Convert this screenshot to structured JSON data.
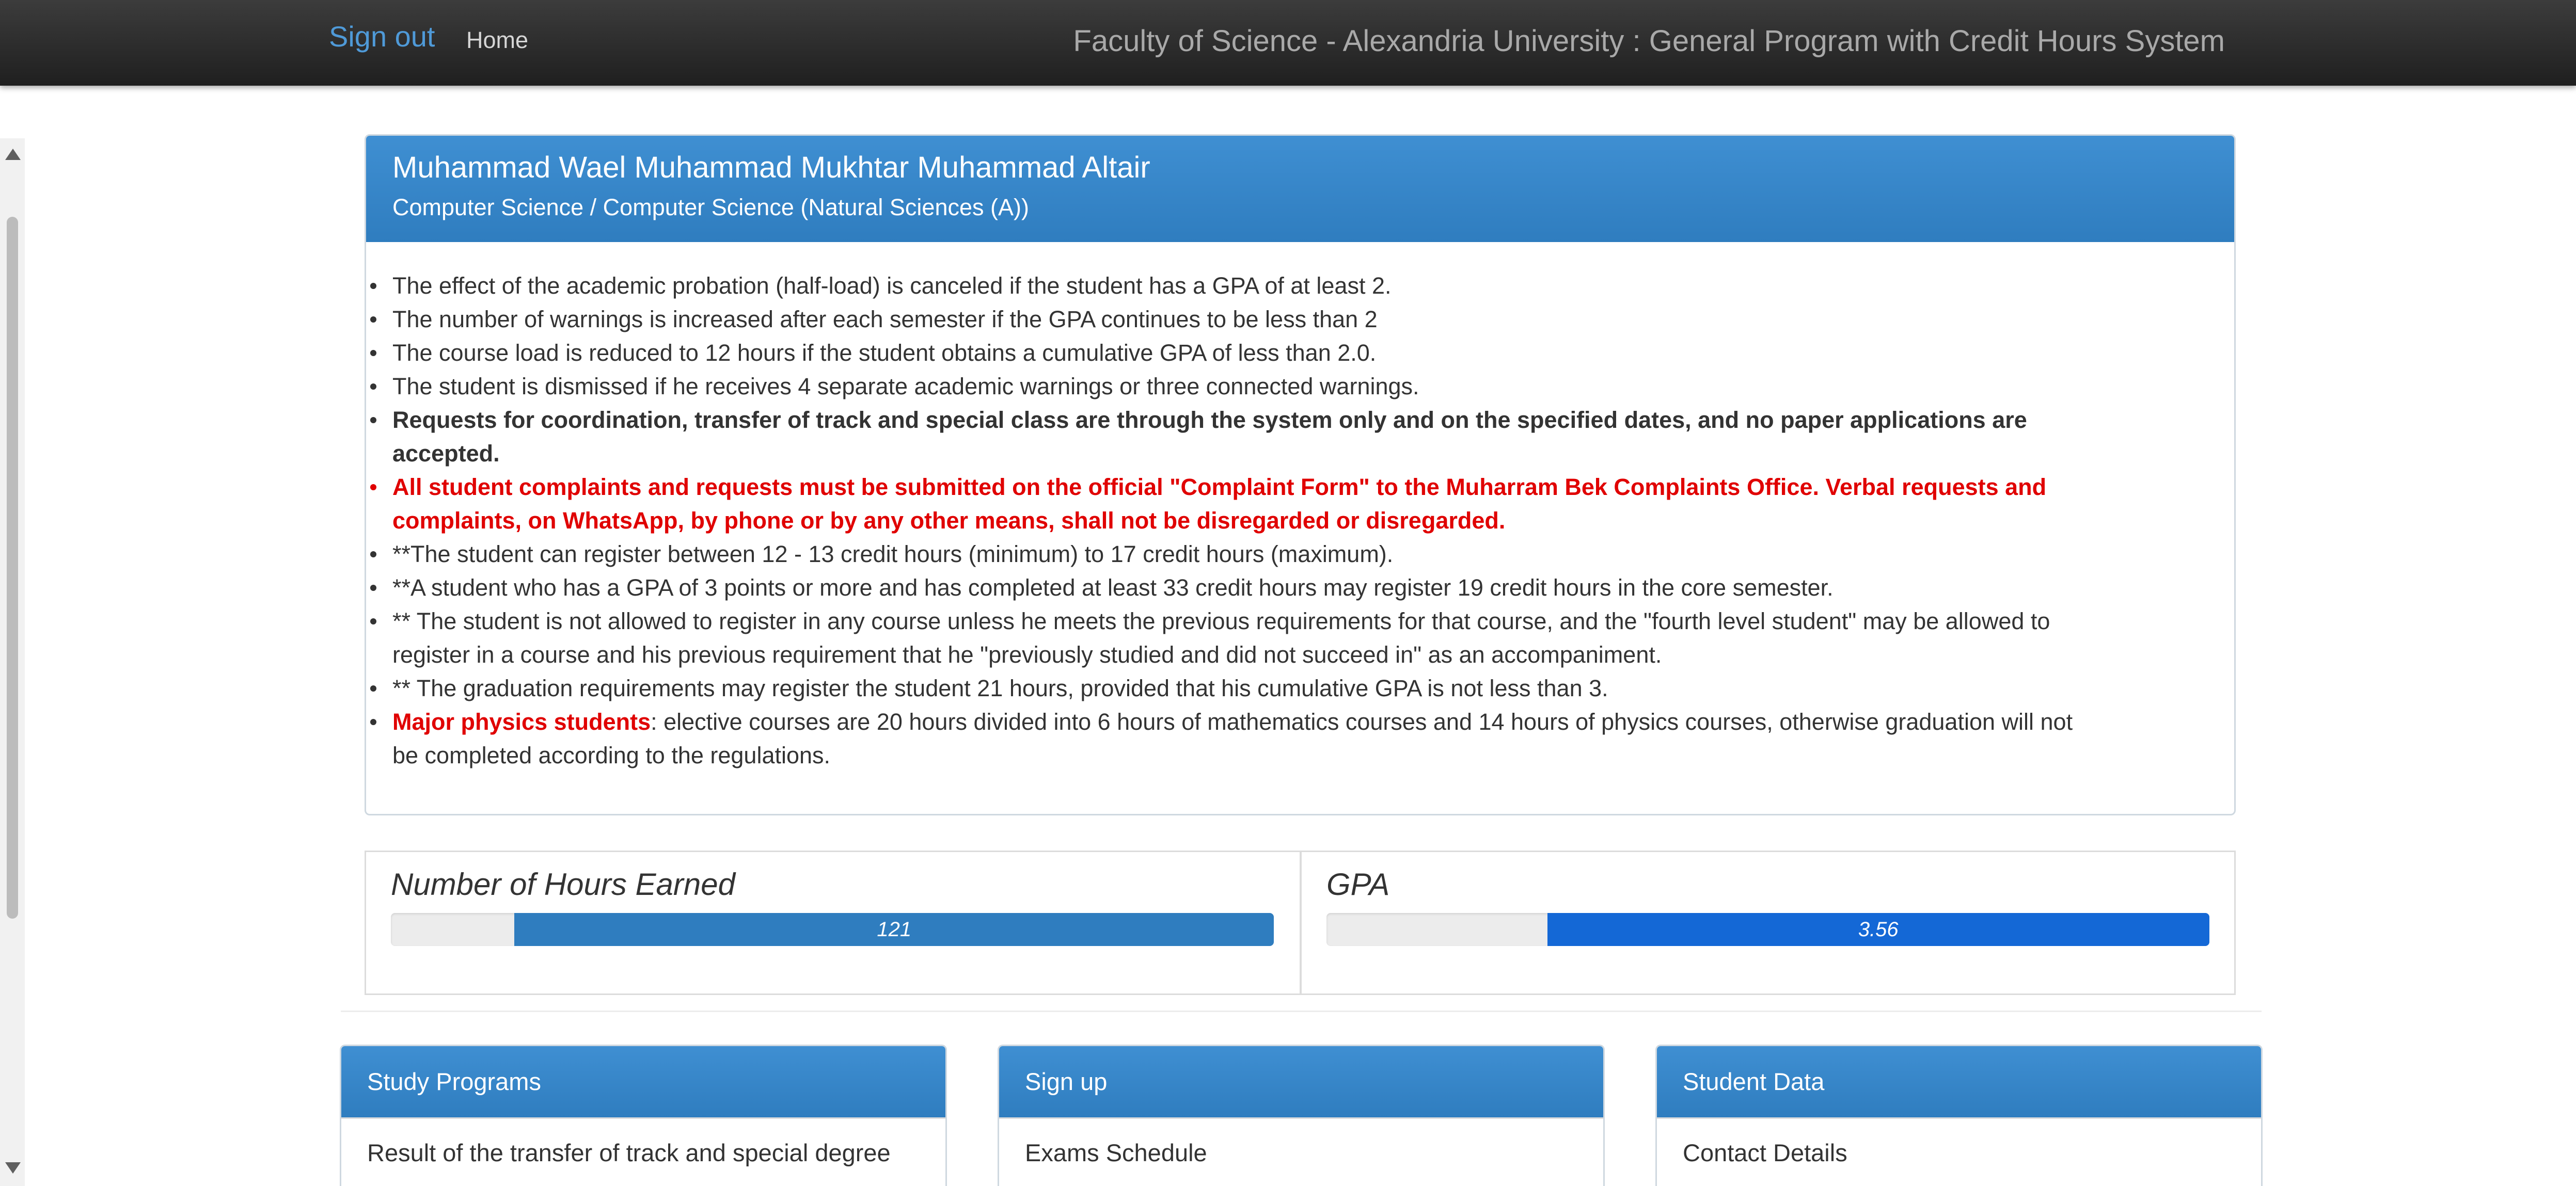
{
  "navbar": {
    "sign_out": "Sign out",
    "home": "Home",
    "brand": "Faculty of Science - Alexandria University : General Program with Credit Hours System"
  },
  "student": {
    "name": "Muhammad Wael Muhammad Mukhtar Muhammad Altair",
    "program": "Computer Science / Computer Science (Natural Sciences (A))"
  },
  "notes": [
    "The effect of the academic probation (half-load) is canceled if the student has a GPA of at least 2.",
    "The number of warnings is increased after each semester if the GPA continues to be less than 2",
    "The course load is reduced to 12 hours if the student obtains a cumulative GPA of less than 2.0.",
    "The student is dismissed if he receives 4 separate academic warnings or three connected warnings.",
    "Requests for coordination, transfer of track and special class are through the system only and on the specified dates, and no paper applications are accepted.",
    "All student complaints and requests must be submitted on the official \"Complaint Form\" to the Muharram Bek Complaints Office. Verbal requests and complaints, on WhatsApp, by phone or by any other means, shall not be disregarded or disregarded.",
    "**The student can register between 12 - 13 credit hours (minimum) to 17 credit hours (maximum).",
    "**A student who has a GPA of 3 points or more and has completed at least 33 credit hours may register 19 credit hours in the core semester.",
    "** The student is not allowed to register in any course unless he meets the previous requirements for that course, and the \"fourth level student\" may be allowed to register in a course and his previous requirement that he \"previously studied and did not succeed in\" as an accompaniment.",
    "** The graduation requirements may register the student 21 hours, provided that his cumulative GPA is not less than 3."
  ],
  "note_physics": {
    "highlight": "Major physics students",
    "rest": ": elective courses are 20 hours divided into 6 hours of mathematics courses and 14 hours of physics courses, otherwise graduation will not be completed according to the regulations."
  },
  "stats": {
    "hours": {
      "title": "Number of Hours Earned",
      "value": "121",
      "fill_fraction": 0.86
    },
    "gpa": {
      "title": "GPA",
      "value": "3.56",
      "fill_fraction": 0.75
    }
  },
  "panels": [
    {
      "title": "Study Programs",
      "item": "Result of the transfer of track and special degree"
    },
    {
      "title": "Sign up",
      "item": "Exams Schedule"
    },
    {
      "title": "Student Data",
      "item": "Contact Details"
    }
  ],
  "colors": {
    "navbar": "#2b2b2b",
    "accent_blue": "#3483c8",
    "alert_red": "#e00000",
    "gpa_bar": "#1468d6"
  }
}
